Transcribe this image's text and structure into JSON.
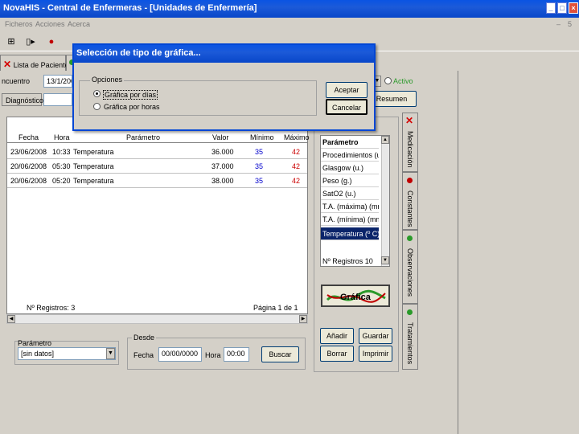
{
  "window": {
    "title": "NovaHIS - Central de Enfermeras - [Unidades de Enfermería]",
    "controls": [
      "_",
      "□",
      "×"
    ],
    "mdi_controls": [
      "–",
      "5"
    ]
  },
  "menu": [
    "Ficheros",
    "Acciones",
    "Acerca"
  ],
  "tabs": {
    "patients_tab": "Lista de Pacientes"
  },
  "form": {
    "encuentro_label": "ncuentro",
    "encuentro_value": "13/1/200",
    "diagnostico_label": "Diagnóstico",
    "activo_label": "Activo",
    "resumen_button": "Resumen"
  },
  "table": {
    "headers": [
      "Fecha",
      "Hora",
      "Parámetro",
      "Valor",
      "Mínimo",
      "Máximo"
    ],
    "rows": [
      {
        "fecha": "23/06/2008",
        "hora": "10:33",
        "parametro": "Temperatura",
        "valor": "36.000",
        "minimo": "35",
        "maximo": "42"
      },
      {
        "fecha": "20/06/2008",
        "hora": "05:30",
        "parametro": "Temperatura",
        "valor": "37.000",
        "minimo": "35",
        "maximo": "42"
      },
      {
        "fecha": "20/06/2008",
        "hora": "05:20",
        "parametro": "Temperatura",
        "valor": "38.000",
        "minimo": "35",
        "maximo": "42"
      }
    ],
    "registros": "Nº Registros: 3",
    "pagina": "Página 1 de 1"
  },
  "parameters": {
    "header": "Parámetro",
    "items": [
      "Procedimientos (u.)",
      "Glasgow (u.)",
      "Peso (g.)",
      "SatO2 (u.)",
      "T.A. (máxima) (mm",
      "T.A. (mínima) (mm-",
      "Temperatura (º C)"
    ],
    "selected_index": 6,
    "registros": "Nº Registros 10"
  },
  "grafica_button": "Gráfica",
  "bottom": {
    "parametro_label": "Parámetro",
    "parametro_value": "[sin datos]",
    "desde_label": "Desde",
    "fecha_label": "Fecha",
    "fecha_value": "00/00/0000",
    "hora_label": "Hora",
    "hora_value": "00:00",
    "buscar_button": "Buscar",
    "anadir_button": "Añadir",
    "guardar_button": "Guardar",
    "borrar_button": "Borrar",
    "imprimir_button": "Imprimir"
  },
  "side_tabs": [
    "Medicación",
    "Constantes",
    "Observaciones",
    "Tratamientos"
  ],
  "dialog": {
    "title": "Selección de tipo de gráfica...",
    "group_label": "Opciones",
    "option1": "Gráfica por días",
    "option2": "Gráfica por horas",
    "selected_option": 1,
    "accept_button": "Aceptar",
    "cancel_button": "Cancelar"
  },
  "colors": {
    "title_bar": "#0a54e3",
    "accent_red": "#d40000",
    "selection": "#0a246a",
    "tab_dot_green": "#2a9a2a"
  }
}
